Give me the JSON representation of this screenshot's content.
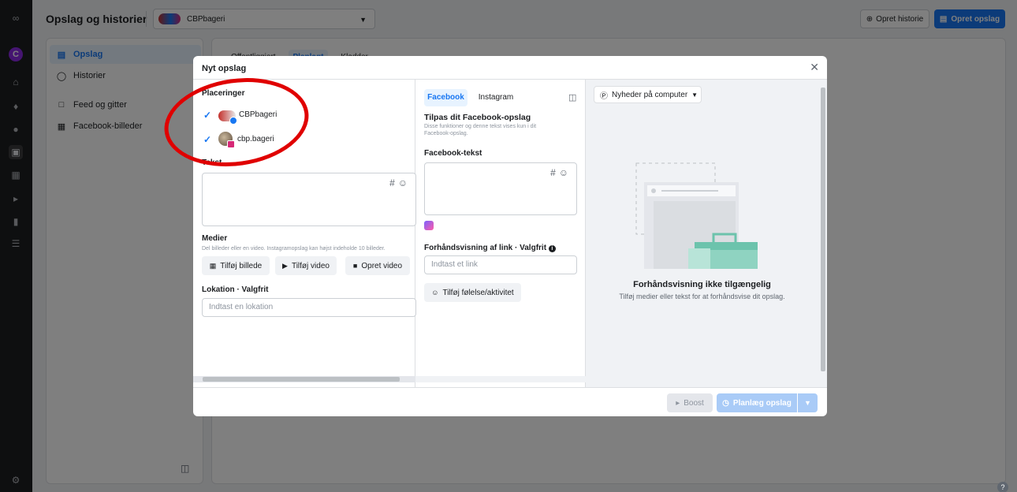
{
  "header": {
    "title": "Opslag og historier",
    "account_name": "CBPbageri",
    "create_story_label": "Opret historie",
    "create_post_label": "Opret opslag"
  },
  "sidebar": {
    "items": [
      {
        "label": "Opslag",
        "icon": "posts-icon",
        "active": true
      },
      {
        "label": "Historier",
        "icon": "stories-icon",
        "active": false
      },
      {
        "label": "Feed og gitter",
        "icon": "feed-grid-icon",
        "active": false
      },
      {
        "label": "Facebook-billeder",
        "icon": "photos-icon",
        "active": false
      }
    ]
  },
  "main": {
    "tabs": [
      "Offentliggjort",
      "Planlagt",
      "Kladder"
    ]
  },
  "modal": {
    "title": "Nyt opslag",
    "placements": {
      "label": "Placeringer",
      "items": [
        {
          "name": "CBPbageri",
          "checked": true,
          "network": "facebook"
        },
        {
          "name": "cbp.bageri",
          "checked": true,
          "network": "instagram"
        }
      ]
    },
    "text_label": "Tekst",
    "media": {
      "label": "Medier",
      "hint": "Del billeder eller en video. Instagramopslag kan højst indeholde 10 billeder.",
      "add_photo": "Tilføj billede",
      "add_video": "Tilføj video",
      "create_video": "Opret video"
    },
    "location": {
      "label": "Lokation · Valgfrit",
      "placeholder": "Indtast en lokation"
    },
    "network_tabs": {
      "facebook": "Facebook",
      "instagram": "Instagram"
    },
    "customize": {
      "title": "Tilpas dit Facebook-opslag",
      "hint": "Disse funktioner og denne tekst vises kun i dit Facebook-opslag.",
      "fb_text_label": "Facebook-tekst",
      "link_label": "Forhåndsvisning af link · Valgfrit",
      "link_placeholder": "Indtast et link",
      "feeling_label": "Tilføj følelse/aktivitet"
    },
    "preview": {
      "selector": "Nyheder på computer",
      "title": "Forhåndsvisning ikke tilgængelig",
      "subtitle": "Tilføj medier eller tekst for at forhåndsvise dit opslag."
    },
    "footer": {
      "boost": "Boost",
      "schedule": "Planlæg opslag"
    }
  },
  "colors": {
    "accent": "#1877f2",
    "annotation": "#e00000"
  }
}
